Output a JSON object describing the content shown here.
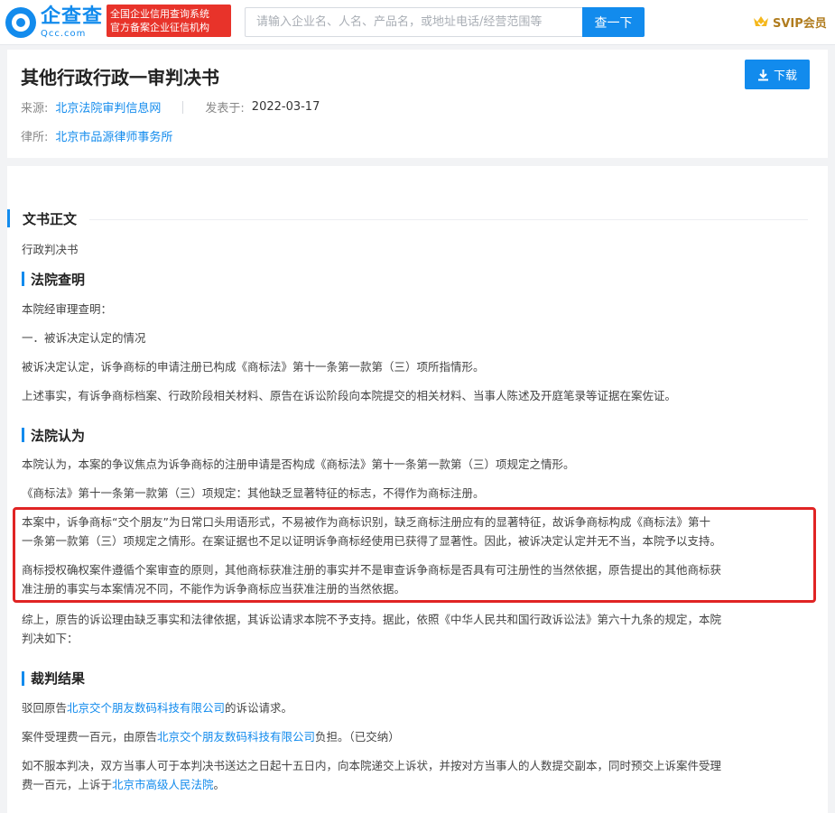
{
  "header": {
    "logo_cn": "企查查",
    "logo_en": "Qcc.com",
    "cert_line1": "全国企业信用查询系统",
    "cert_line2": "官方备案企业征信机构",
    "search_placeholder": "请输入企业名、人名、产品名，或地址电话/经营范围等",
    "search_button": "查一下",
    "svip_label": "SVIP会员"
  },
  "document": {
    "title": "其他行政行政一审判决书",
    "download_label": "下载",
    "source_label": "来源:",
    "source_value": "北京法院审判信息网",
    "published_label": "发表于:",
    "published_value": "2022-03-17",
    "lawfirm_label": "律所:",
    "lawfirm_value": "北京市品源律师事务所"
  },
  "body": {
    "main_heading": "文书正文",
    "doc_type": "行政判决书",
    "findings": {
      "heading": "法院查明",
      "p1": "本院经审理查明：",
      "p2": "一．被诉决定认定的情况",
      "p3": "被诉决定认定，诉争商标的申请注册已构成《商标法》第十一条第一款第（三）项所指情形。",
      "p4": "上述事实，有诉争商标档案、行政阶段相关材料、原告在诉讼阶段向本院提交的相关材料、当事人陈述及开庭笔录等证据在案佐证。"
    },
    "opinion": {
      "heading": "法院认为",
      "p1": "本院认为，本案的争议焦点为诉争商标的注册申请是否构成《商标法》第十一条第一款第（三）项规定之情形。",
      "p2": "《商标法》第十一条第一款第（三）项规定：其他缺乏显著特征的标志，不得作为商标注册。",
      "p3_line1": "本案中，诉争商标“交个朋友”为日常口头用语形式，不易被作为商标识别，缺乏商标注册应有的显著特征，故诉争商标构成《商标法》第十",
      "p3_line2": "一条第一款第（三）项规定之情形。在案证据也不足以证明诉争商标经使用已获得了显著性。因此，被诉决定认定并无不当，本院予以支持。",
      "p4_line1": "商标授权确权案件遵循个案审查的原则，其他商标获准注册的事实并不是审查诉争商标是否具有可注册性的当然依据，原告提出的其他商标获",
      "p4_line2": "准注册的事实与本案情况不同，不能作为诉争商标应当获准注册的当然依据。",
      "p5_line1": "综上，原告的诉讼理由缺乏事实和法律依据，其诉讼请求本院不予支持。据此，依照《中华人民共和国行政诉讼法》第六十九条的规定，本院",
      "p5_line2": "判决如下："
    },
    "judgment": {
      "heading": "裁判结果",
      "p1_pre": "驳回原告",
      "p1_link": "北京交个朋友数码科技有限公司",
      "p1_post": "的诉讼请求。",
      "p2_pre": "案件受理费一百元，由原告",
      "p2_link": "北京交个朋友数码科技有限公司",
      "p2_post": "负担。（已交纳）",
      "p3_line1": "如不服本判决，双方当事人可于本判决书送达之日起十五日内，向本院递交上诉状，并按对方当事人的人数提交副本，同时预交上诉案件受理",
      "p3_pre2": "费一百元，上诉于",
      "p3_link": "北京市高级人民法院",
      "p3_post": "。"
    }
  },
  "colors": {
    "brand": "#128bed",
    "cert_red": "#e8332a",
    "highlight_red": "#e02424",
    "vip_gold": "#b07c1e"
  }
}
